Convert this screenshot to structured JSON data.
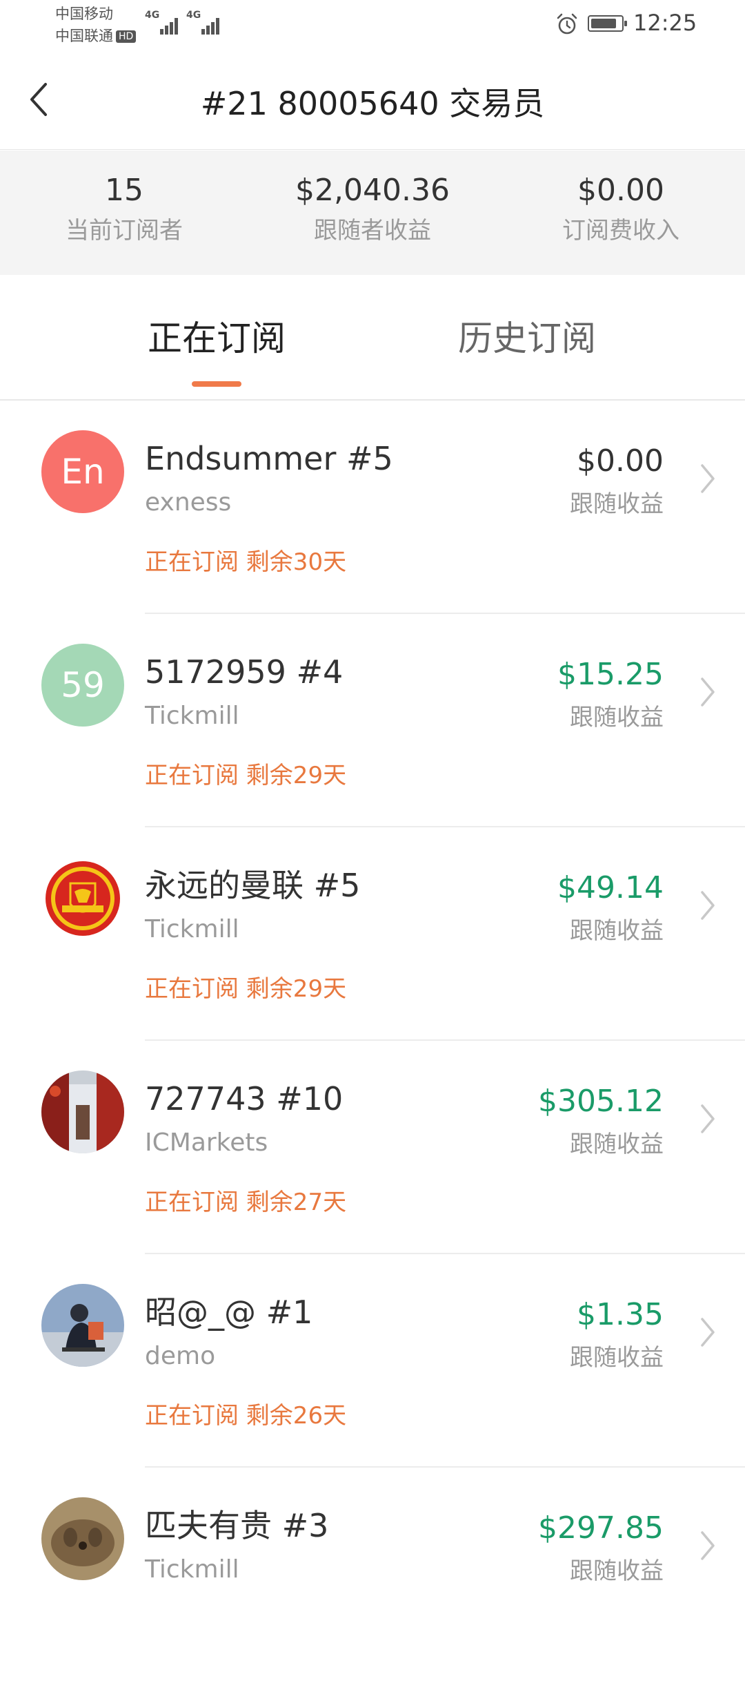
{
  "status_bar": {
    "carrier1": "中国移动",
    "carrier2": "中国联通",
    "hd_badge": "HD",
    "network1": "4G",
    "network2": "4G",
    "time": "12:25",
    "battery_level": 0.85,
    "icons": [
      "signal-icon",
      "alarm-icon",
      "battery-icon"
    ]
  },
  "header": {
    "title": "#21 80005640 交易员",
    "back_icon": "chevron-left-icon"
  },
  "stats": [
    {
      "value": "15",
      "label": "当前订阅者"
    },
    {
      "value": "$2,040.36",
      "label": "跟随者收益"
    },
    {
      "value": "$0.00",
      "label": "订阅费收入"
    }
  ],
  "tabs": [
    {
      "label": "正在订阅",
      "active": true
    },
    {
      "label": "历史订阅",
      "active": false
    }
  ],
  "colors": {
    "accent": "#f07a4a",
    "status_orange": "#e8783e",
    "profit_green": "#1a9b68",
    "neutral_text": "#333333",
    "muted_text": "#9a9a9a"
  },
  "subscriptions": [
    {
      "name": "Endsummer #5",
      "broker": "exness",
      "status": "正在订阅 剩余30天",
      "profit": "$0.00",
      "profit_label": "跟随收益",
      "avatar_text": "En",
      "avatar_color": "#f8716b",
      "avatar_kind": "text",
      "profit_color": "#333333"
    },
    {
      "name": "5172959 #4",
      "broker": "Tickmill",
      "status": "正在订阅 剩余29天",
      "profit": "$15.25",
      "profit_label": "跟随收益",
      "avatar_text": "59",
      "avatar_color": "#a4d8b6",
      "avatar_kind": "text",
      "profit_color": "#1a9b68"
    },
    {
      "name": "永远的曼联 #5",
      "broker": "Tickmill",
      "status": "正在订阅 剩余29天",
      "profit": "$49.14",
      "profit_label": "跟随收益",
      "avatar_kind": "crest",
      "profit_color": "#1a9b68"
    },
    {
      "name": "727743 #10",
      "broker": "ICMarkets",
      "status": "正在订阅 剩余27天",
      "profit": "$305.12",
      "profit_label": "跟随收益",
      "avatar_kind": "photo-street",
      "profit_color": "#1a9b68"
    },
    {
      "name": "昭@_@ #1",
      "broker": "demo",
      "status": "正在订阅 剩余26天",
      "profit": "$1.35",
      "profit_label": "跟随收益",
      "avatar_kind": "photo-person",
      "profit_color": "#1a9b68"
    },
    {
      "name": "匹夫有贵 #3",
      "broker": "Tickmill",
      "status": "",
      "profit": "$297.85",
      "profit_label": "跟随收益",
      "avatar_kind": "photo-dog",
      "profit_color": "#1a9b68"
    }
  ]
}
